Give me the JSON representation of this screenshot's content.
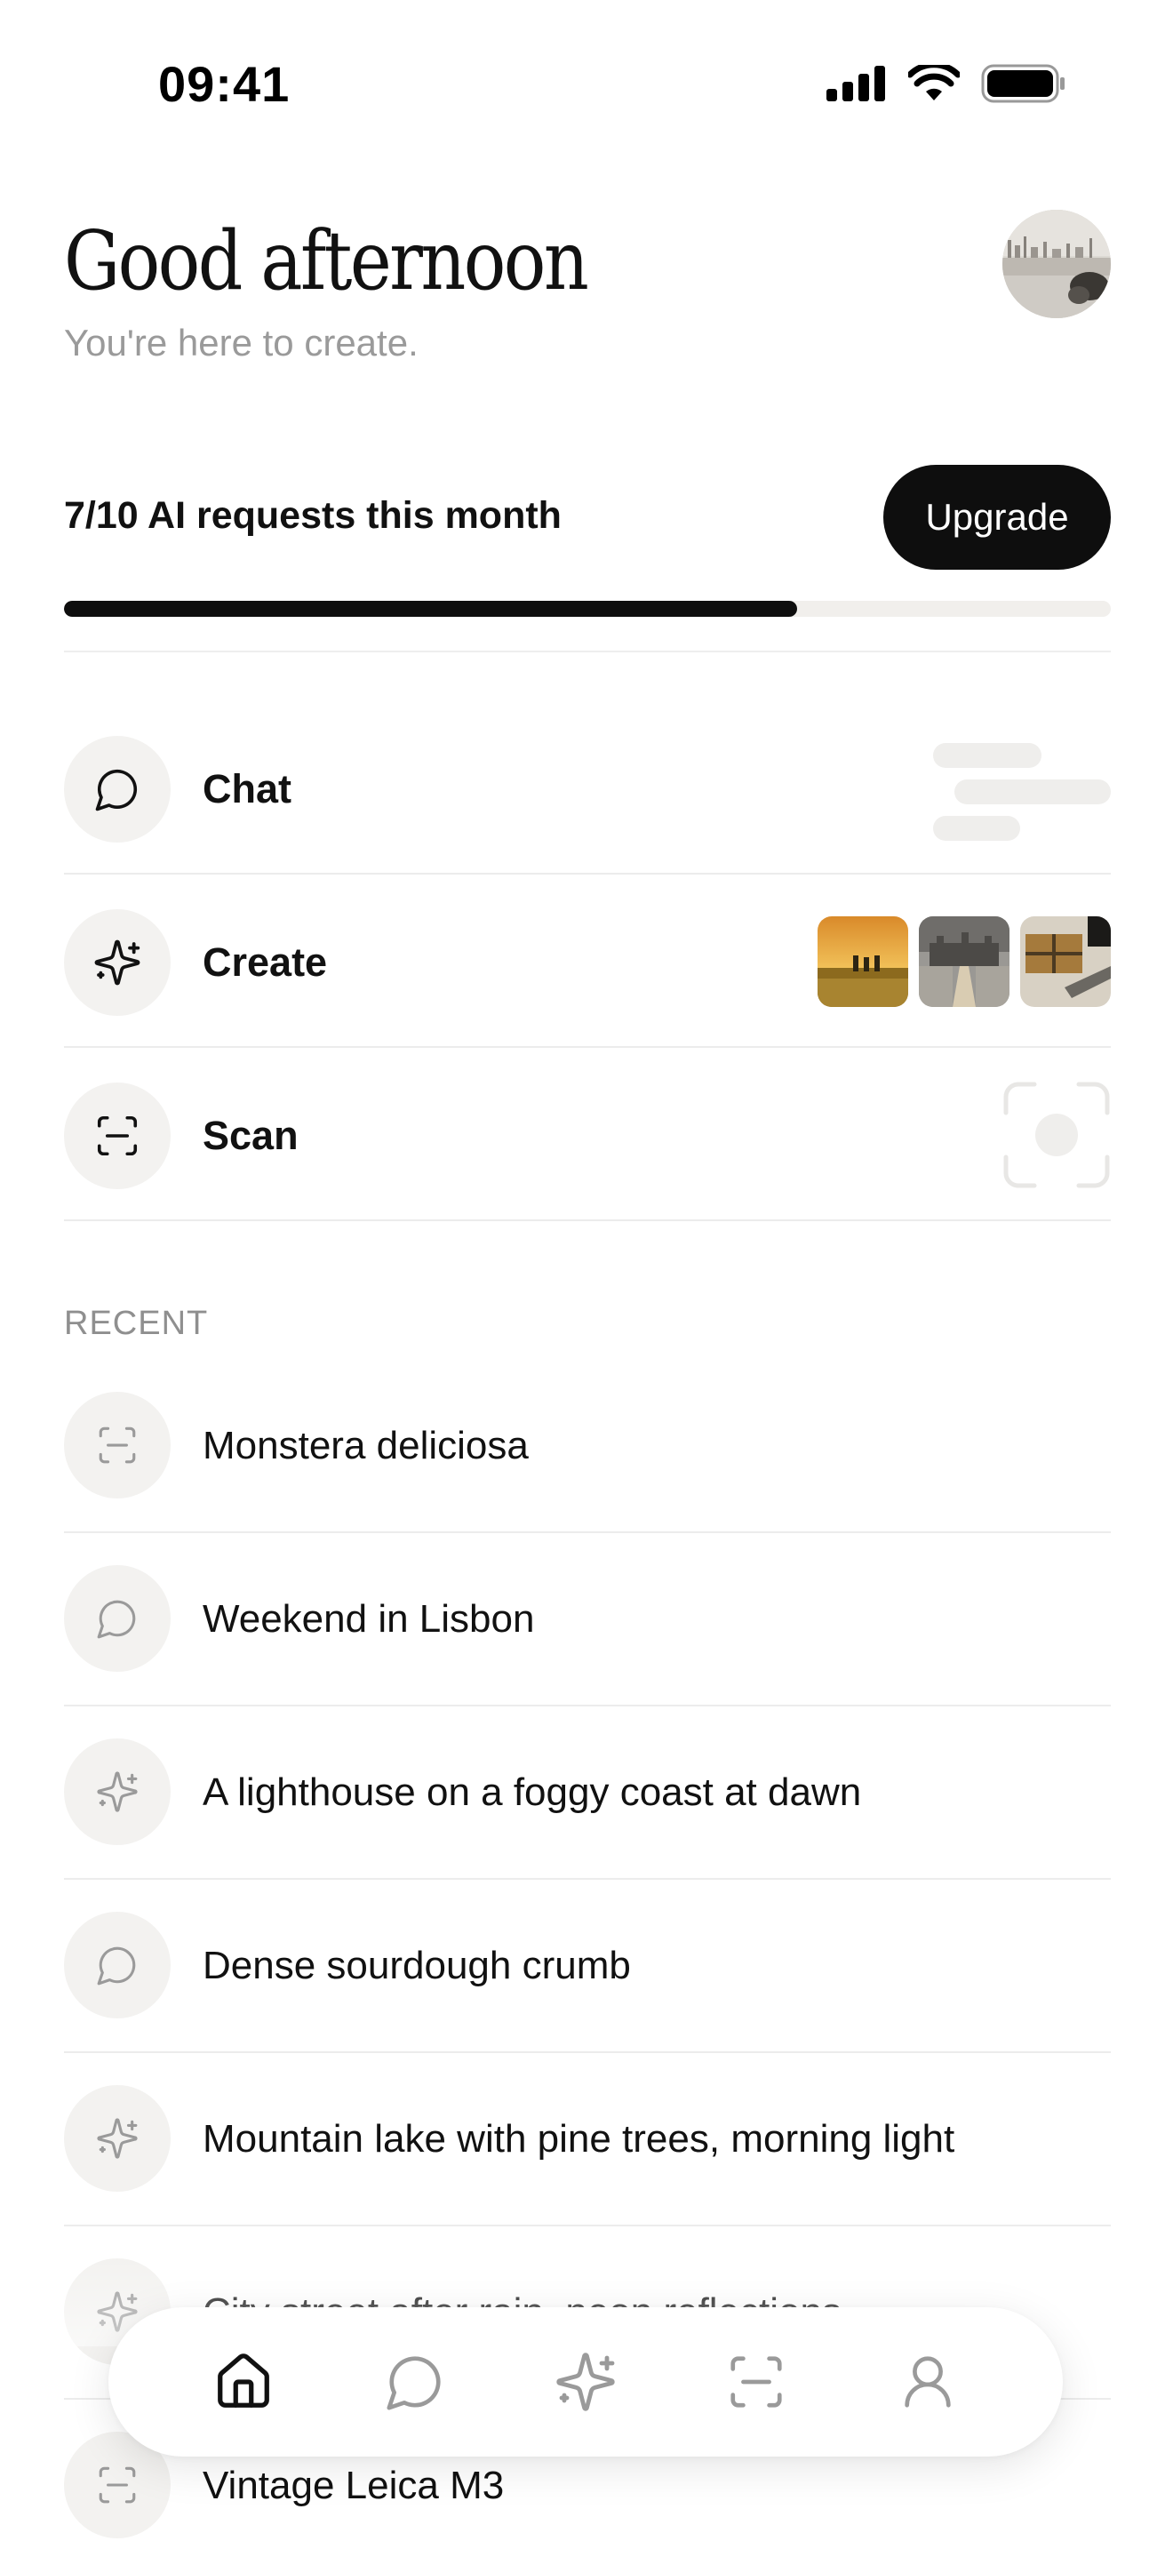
{
  "status_bar": {
    "time": "09:41",
    "icons": [
      "cellular-signal-icon",
      "wifi-icon",
      "battery-icon"
    ]
  },
  "header": {
    "greeting": "Good afternoon",
    "subtitle": "You're here to create.",
    "avatar": "avatar-photo"
  },
  "usage": {
    "label": "7/10 AI requests this month",
    "used": 7,
    "limit": 10,
    "progress_fraction": 0.7,
    "upgrade_label": "Upgrade"
  },
  "actions": [
    {
      "label": "Chat",
      "icon": "chat-bubble-icon",
      "preview": "text-lines-placeholder"
    },
    {
      "label": "Create",
      "icon": "sparkle-icon",
      "preview": "image-thumbnails"
    },
    {
      "label": "Scan",
      "icon": "scan-icon",
      "preview": "scan-frame-placeholder"
    }
  ],
  "recent": {
    "heading": "RECENT",
    "items": [
      {
        "label": "Monstera deliciosa",
        "icon": "scan-icon"
      },
      {
        "label": "Weekend in Lisbon",
        "icon": "chat-bubble-icon"
      },
      {
        "label": "A lighthouse on a foggy coast at dawn",
        "icon": "sparkle-icon"
      },
      {
        "label": "Dense sourdough crumb",
        "icon": "chat-bubble-icon"
      },
      {
        "label": "Mountain lake with pine trees, morning light",
        "icon": "sparkle-icon"
      },
      {
        "label": "City street after rain, neon reflections",
        "icon": "sparkle-icon"
      },
      {
        "label": "Vintage Leica M3",
        "icon": "scan-icon"
      }
    ]
  },
  "tab_bar": {
    "items": [
      "home-icon",
      "chat-bubble-icon",
      "sparkle-icon",
      "scan-icon",
      "profile-icon"
    ],
    "active": "home-icon"
  },
  "colors": {
    "accent": "#0e0e0e",
    "muted_text": "#9a9a9a",
    "icon_circle": "#f3f2f0",
    "divider": "#ececec"
  }
}
